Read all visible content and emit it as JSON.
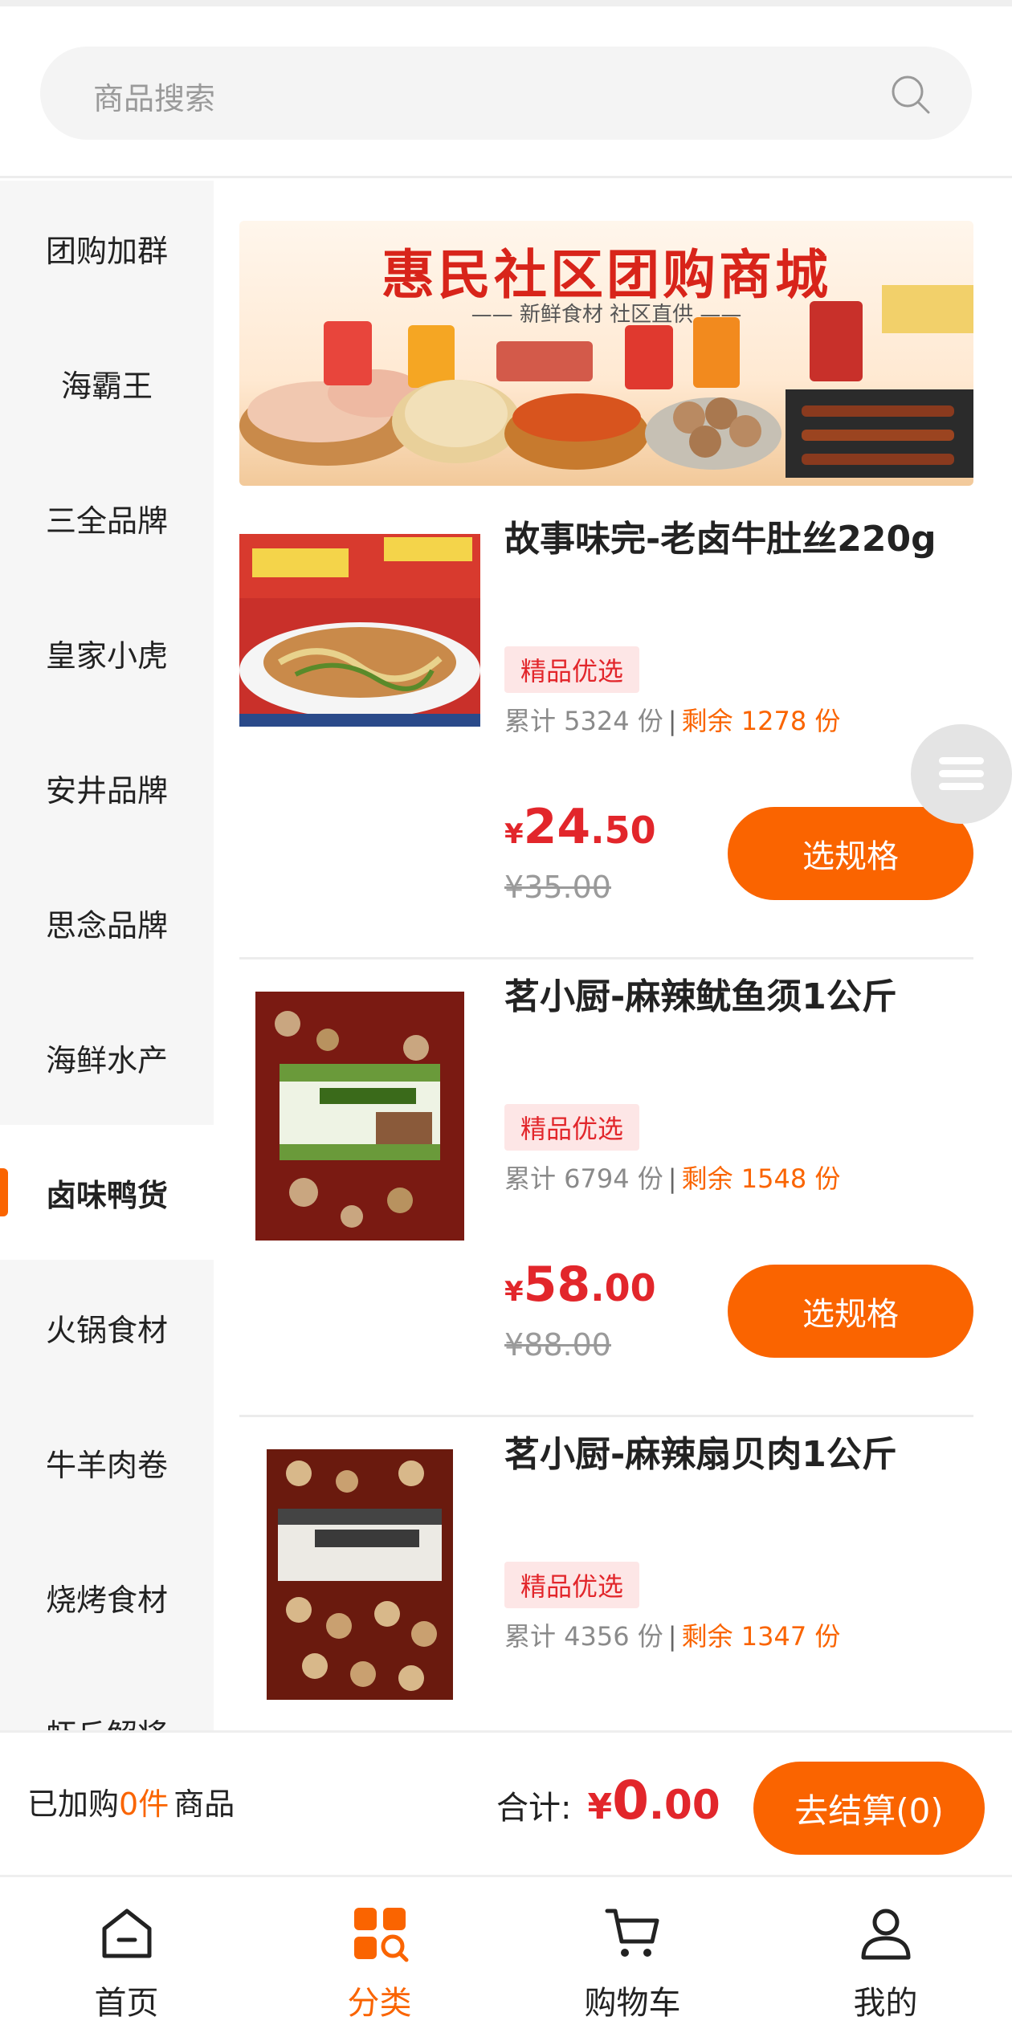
{
  "search": {
    "placeholder": "商品搜索"
  },
  "sidebar": {
    "items": [
      {
        "label": "团购加群"
      },
      {
        "label": "海霸王"
      },
      {
        "label": "三全品牌"
      },
      {
        "label": "皇家小虎"
      },
      {
        "label": "安井品牌"
      },
      {
        "label": "思念品牌"
      },
      {
        "label": "海鲜水产"
      },
      {
        "label": "卤味鸭货",
        "active": true
      },
      {
        "label": "火锅食材"
      },
      {
        "label": "牛羊肉卷"
      },
      {
        "label": "烧烤食材"
      },
      {
        "label": "虾丘解将"
      }
    ]
  },
  "banner": {
    "title": "惠民社区团购商城",
    "subtitle": "—— 新鲜食材 社区直供 ——"
  },
  "products": [
    {
      "name": "故事味完-老卤牛肚丝220g",
      "tag": "精品优选",
      "sold_label": "累计 5324 份",
      "remain_label": "剩余 1278 份",
      "price_currency": "¥",
      "price_int": "24",
      "price_dec": ".50",
      "original_price": "¥35.00",
      "button": "选规格"
    },
    {
      "name": "茗小厨-麻辣鱿鱼须1公斤",
      "tag": "精品优选",
      "sold_label": "累计 6794 份",
      "remain_label": "剩余 1548 份",
      "price_currency": "¥",
      "price_int": "58",
      "price_dec": ".00",
      "original_price": "¥88.00",
      "button": "选规格"
    },
    {
      "name": "茗小厨-麻辣扇贝肉1公斤",
      "tag": "精品优选",
      "sold_label": "累计 4356 份",
      "remain_label": "剩余 1347 份"
    }
  ],
  "cart": {
    "added_prefix": "已加购",
    "added_count": "0件",
    "added_suffix": "商品",
    "total_label": "合计:",
    "total_currency": "¥",
    "total_int": "0",
    "total_dec": ".00",
    "checkout_label": "去结算(0)"
  },
  "tabbar": {
    "tabs": [
      {
        "label": "首页"
      },
      {
        "label": "分类",
        "active": true
      },
      {
        "label": "购物车"
      },
      {
        "label": "我的"
      }
    ]
  },
  "colors": {
    "accent": "#fa6400",
    "price_red": "#e2262b",
    "tag_bg": "#fde6e6"
  }
}
